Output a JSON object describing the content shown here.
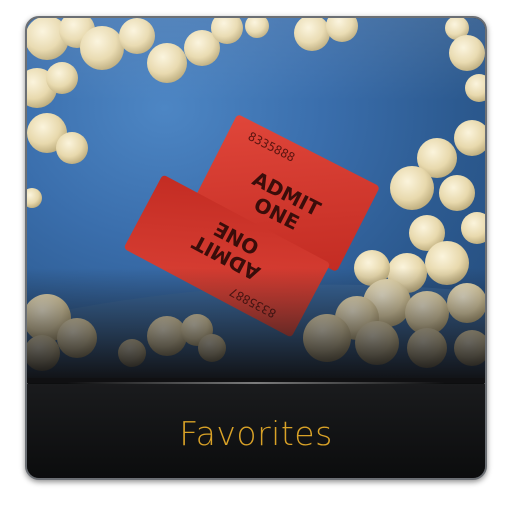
{
  "tile": {
    "caption": "Favorites",
    "caption_color": "#d9a227",
    "photo_subject": "admit-one-tickets-and-popcorn",
    "tickets": [
      {
        "serial": "8335888",
        "text_line1": "ADMIT",
        "text_line2": "ONE"
      },
      {
        "serial": "8335887",
        "text_line1": "ADMIT",
        "text_line2": "ONE"
      }
    ]
  },
  "colors": {
    "tile_background": "#0d0e0f",
    "photo_blue": "#3a6eac",
    "ticket_red": "#d2352b",
    "popcorn": "#efe3c0"
  }
}
